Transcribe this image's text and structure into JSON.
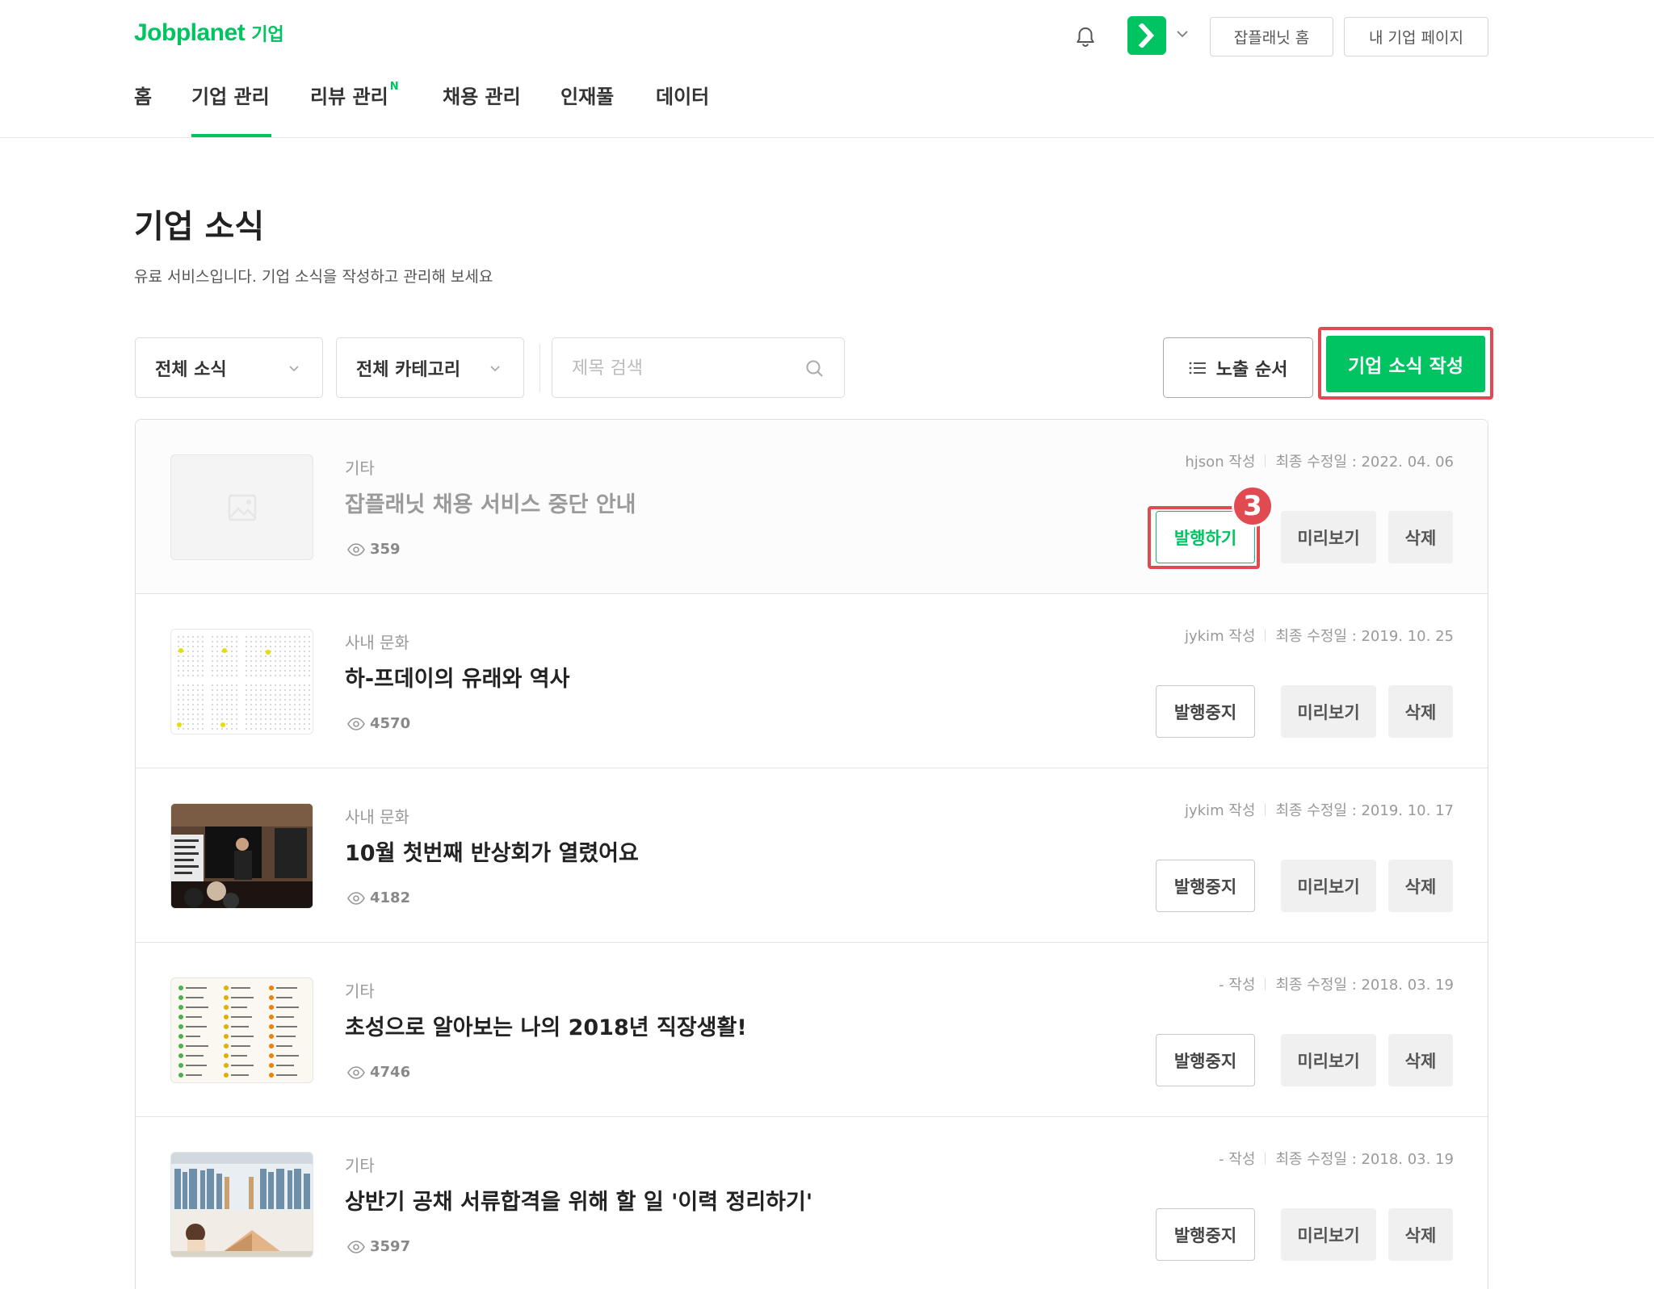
{
  "header": {
    "logo_brand": "Jobplanet",
    "logo_sub": "기업",
    "jobplanet_home_button": "잡플래닛 홈",
    "my_company_button": "내 기업 페이지",
    "nav": [
      "홈",
      "기업 관리",
      "리뷰 관리",
      "채용 관리",
      "인재풀",
      "데이터"
    ],
    "nav_new_badge": "N",
    "active_nav": "기업 관리"
  },
  "page": {
    "title": "기업 소식",
    "description": "유료 서비스입니다. 기업 소식을 작성하고 관리해 보세요"
  },
  "filters": {
    "news_select": "전체 소식",
    "category_select": "전체 카테고리",
    "search_placeholder": "제목 검색",
    "order_button": "노출 순서",
    "write_button": "기업 소식 작성"
  },
  "step_badge": "3",
  "posts": [
    {
      "category": "기타",
      "title": "잡플래닛 채용 서비스 중단 안내",
      "views": "359",
      "author": "hjson 작성",
      "modified": "최종 수정일 : 2022. 04. 06",
      "publish_label": "발행하기",
      "preview_label": "미리보기",
      "delete_label": "삭제"
    },
    {
      "category": "사내 문화",
      "title": "하-프데이의 유래와 역사",
      "views": "4570",
      "author": "jykim 작성",
      "modified": "최종 수정일 : 2019. 10. 25",
      "publish_label": "발행중지",
      "preview_label": "미리보기",
      "delete_label": "삭제"
    },
    {
      "category": "사내 문화",
      "title": "10월 첫번째 반상회가 열렸어요",
      "views": "4182",
      "author": "jykim 작성",
      "modified": "최종 수정일 : 2019. 10. 17",
      "publish_label": "발행중지",
      "preview_label": "미리보기",
      "delete_label": "삭제"
    },
    {
      "category": "기타",
      "title": "초성으로 알아보는 나의 2018년 직장생활!",
      "views": "4746",
      "author": "- 작성",
      "modified": "최종 수정일 : 2018. 03. 19",
      "publish_label": "발행중지",
      "preview_label": "미리보기",
      "delete_label": "삭제"
    },
    {
      "category": "기타",
      "title": "상반기 공채 서류합격을 위해 할 일 '이력 정리하기'",
      "views": "3597",
      "author": "- 작성",
      "modified": "최종 수정일 : 2018. 03. 19",
      "publish_label": "발행중지",
      "preview_label": "미리보기",
      "delete_label": "삭제"
    }
  ],
  "colors": {
    "brand_green": "#00c362",
    "highlight_red": "#e24a52"
  }
}
